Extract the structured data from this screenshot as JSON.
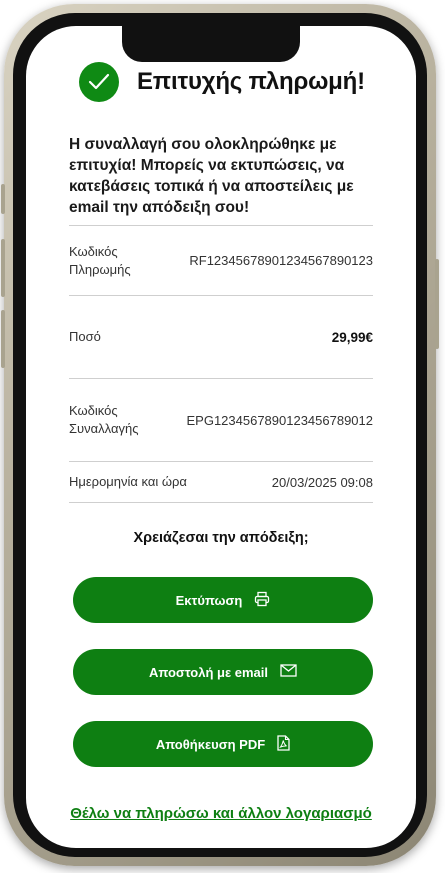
{
  "header": {
    "title": "Επιτυχής πληρωμή!"
  },
  "message": "Η συναλλαγή σου ολοκληρώθηκε με επιτυχία! Μπορείς να εκτυπώσεις, να κατεβάσεις τοπικά ή να αποστείλεις με email την απόδειξη σου!",
  "details": [
    {
      "label": "Κωδικός Πληρωμής",
      "value": "RF12345678901234567890123"
    },
    {
      "label": "Ποσό",
      "value": "29,99€"
    },
    {
      "label": "Κωδικός Συναλλαγής",
      "value": "EPG1234567890123456789012"
    },
    {
      "label": "Ημερομηνία και ώρα",
      "value": "20/03/2025 09:08"
    }
  ],
  "receipt_question": "Χρειάζεσαι την απόδειξη;",
  "buttons": {
    "print": {
      "label": "Εκτύπωση",
      "icon": "printer-icon"
    },
    "email": {
      "label": "Αποστολή με email",
      "icon": "envelope-icon"
    },
    "pdf": {
      "label": "Αποθήκευση PDF",
      "icon": "pdf-icon"
    }
  },
  "pay_another_link": "Θέλω να πληρώσω και άλλον λογαριασμό",
  "colors": {
    "accent": "#0e7f12",
    "success": "#0f8a14"
  }
}
